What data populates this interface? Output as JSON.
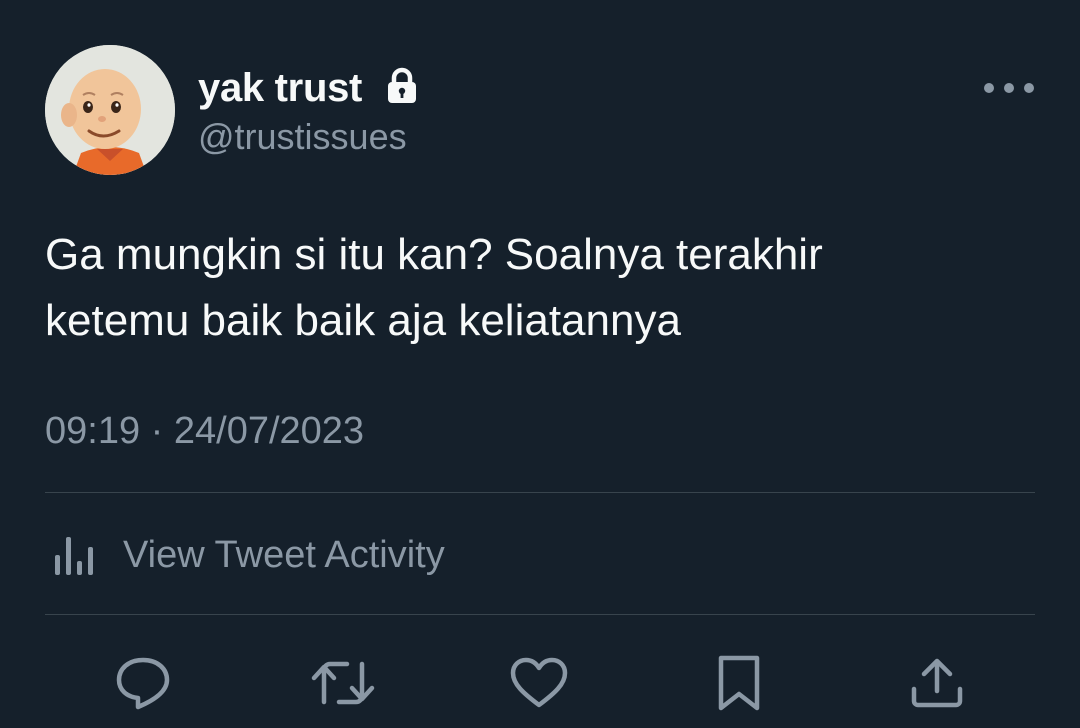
{
  "author": {
    "display_name": "yak trust",
    "handle": "@trustissues",
    "protected_icon": "lock-icon",
    "avatar": "cartoon-boy-avatar"
  },
  "tweet": {
    "text": "Ga mungkin si itu kan? Soalnya terakhir\nketemu baik baik aja keliatannya",
    "timestamp": "09:19 · 24/07/2023"
  },
  "activity": {
    "label": "View Tweet Activity",
    "icon": "bar-chart-icon"
  },
  "actions": [
    "reply-icon",
    "retweet-icon",
    "like-icon",
    "bookmark-icon",
    "share-icon"
  ],
  "colors": {
    "background": "#15202b",
    "primary_text": "#f7f9f9",
    "secondary_text": "#8b98a5",
    "divider": "#38444d"
  }
}
